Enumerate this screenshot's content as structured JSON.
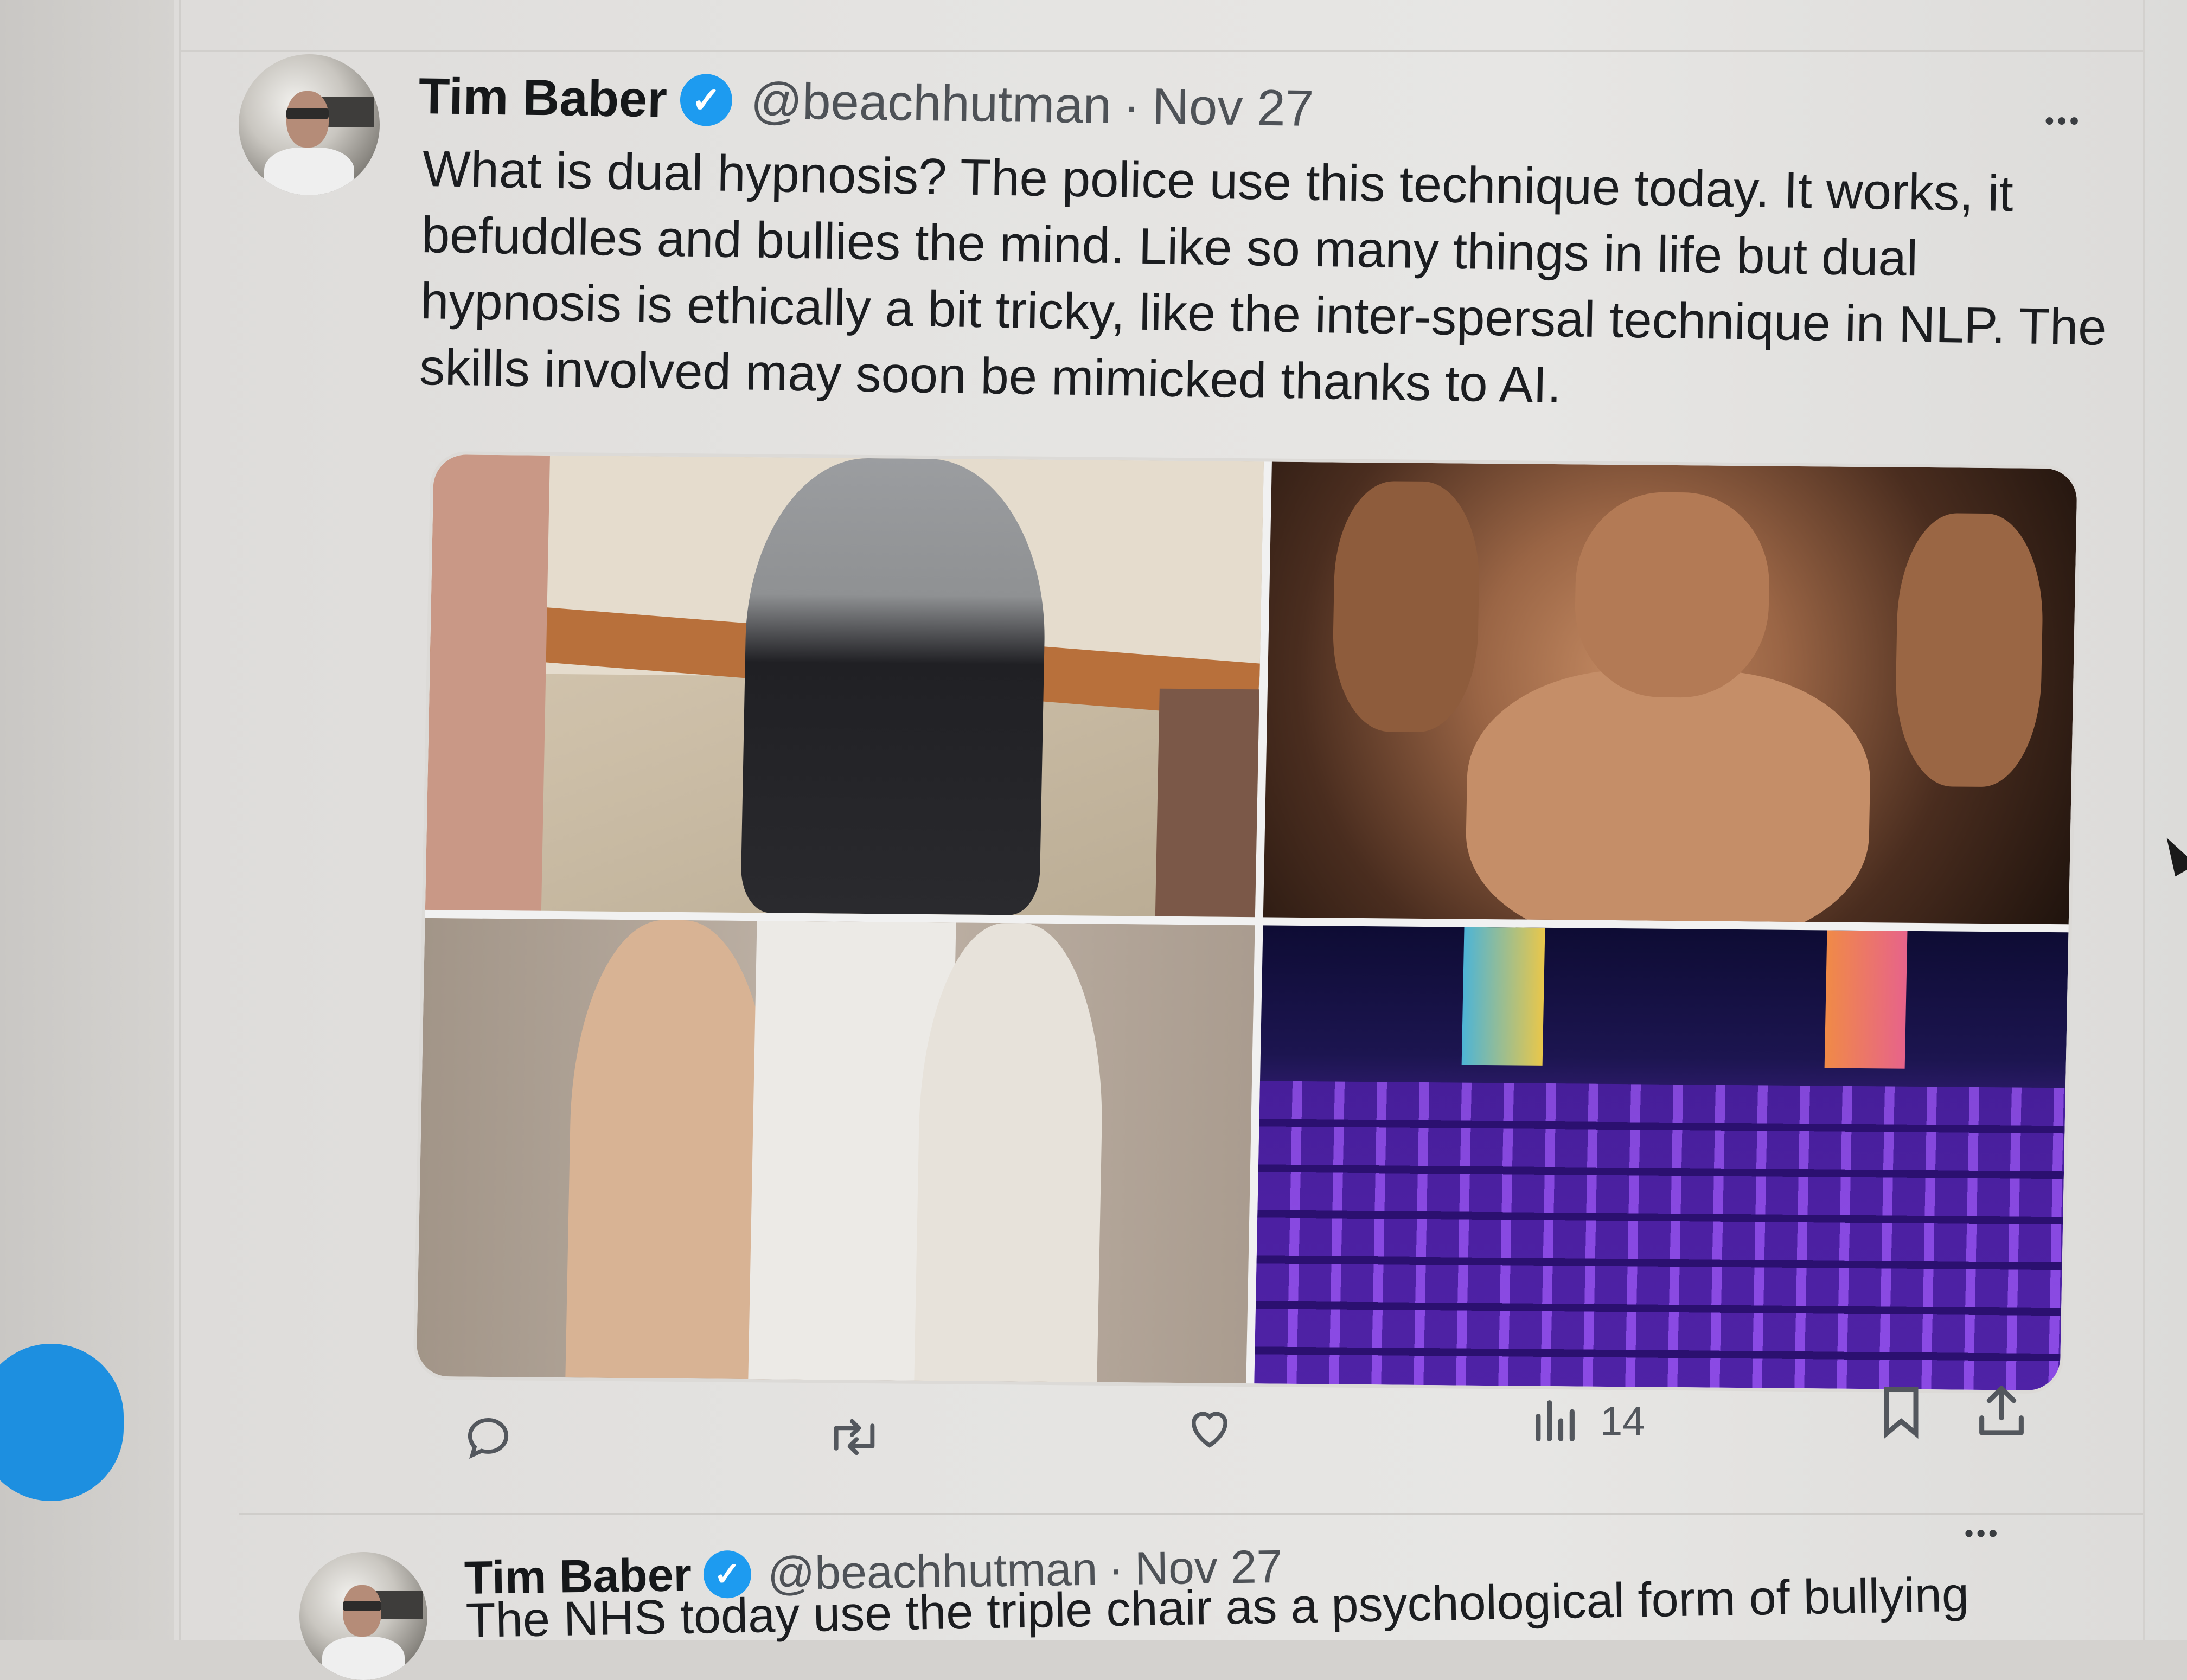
{
  "tweets": [
    {
      "author_name": "Tim Baber",
      "handle": "@beachhutman",
      "separator": "·",
      "date": "Nov 27",
      "more_label": "•••",
      "text_lines": [
        "What is dual hypnosis? The police use this technique today. It works, it",
        "befuddles and bullies the mind. Like so many things in life but dual",
        "hypnosis is ethically a bit tricky, like the inter-spersal technique in NLP. The",
        "skills involved  may soon be mimicked thanks to AI."
      ],
      "media_count": 4,
      "actions": {
        "reply_icon": "reply-icon",
        "repost_icon": "repost-icon",
        "like_icon": "heart-icon",
        "views_icon": "views-chart-icon",
        "views_count": "14",
        "bookmark_icon": "bookmark-icon",
        "share_icon": "share-icon"
      }
    },
    {
      "author_name": "Tim Baber",
      "handle": "@beachhutman",
      "separator": "·",
      "date": "Nov 27",
      "more_label": "•••",
      "text_partial": "The NHS today use the triple chair as a psychological form of bullying"
    }
  ],
  "colors": {
    "verified_blue": "#1d9bf0",
    "compose_button_blue": "#1d8fe0",
    "text_primary": "#1b1d20",
    "text_secondary": "#4e5257"
  }
}
